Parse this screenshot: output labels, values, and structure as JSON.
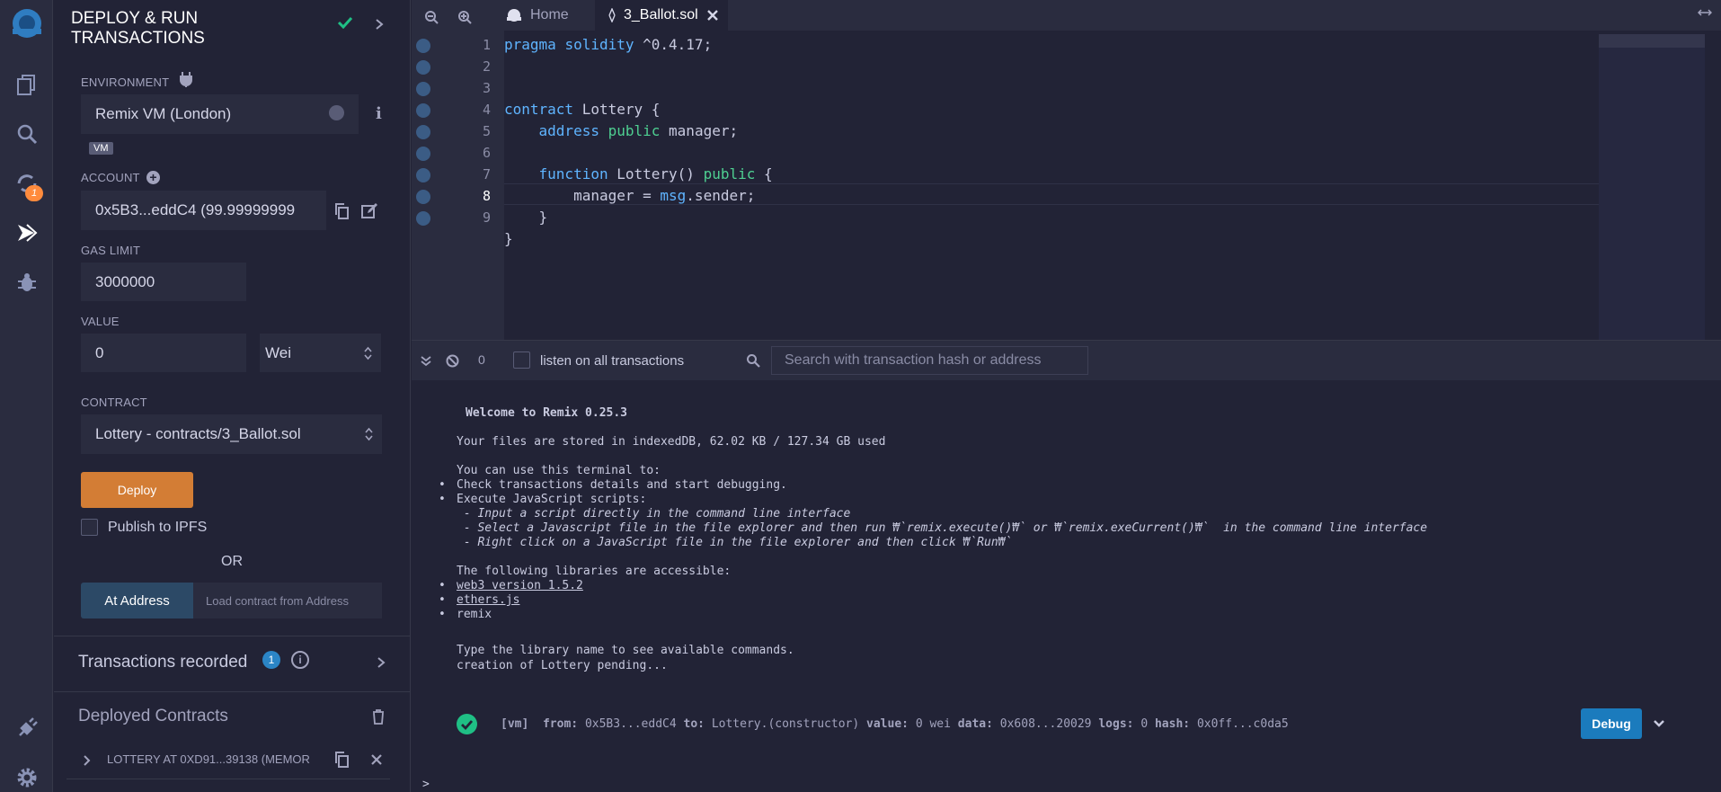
{
  "panel": {
    "title": "DEPLOY & RUN TRANSACTIONS",
    "environment_label": "ENVIRONMENT",
    "environment_value": "Remix VM (London)",
    "vm_badge": "VM",
    "account_label": "ACCOUNT",
    "account_value": "0x5B3...eddC4 (99.99999999",
    "gas_limit_label": "GAS LIMIT",
    "gas_limit_value": "3000000",
    "value_label": "VALUE",
    "value_amount": "0",
    "value_unit": "Wei",
    "contract_label": "CONTRACT",
    "contract_value": "Lottery - contracts/3_Ballot.sol",
    "deploy_label": "Deploy",
    "publish_ipfs_label": "Publish to IPFS",
    "or_label": "OR",
    "at_address_label": "At Address",
    "at_address_placeholder": "Load contract from Address",
    "transactions_recorded_label": "Transactions recorded",
    "transactions_recorded_count": "1",
    "deployed_contracts_label": "Deployed Contracts",
    "deployed_instance": "LOTTERY AT 0XD91...39138 (MEMOR"
  },
  "iconbar": {
    "plugin_badge": "1"
  },
  "tabs": {
    "home_label": "Home",
    "file_label": "3_Ballot.sol"
  },
  "editor": {
    "line_numbers": [
      "1",
      "2",
      "3",
      "4",
      "5",
      "6",
      "7",
      "8",
      "9"
    ]
  },
  "terminal": {
    "tx_count": "0",
    "listen_label": "listen on all transactions",
    "search_placeholder": "Search with transaction hash or address",
    "welcome": "Welcome to Remix 0.25.3",
    "storage": "Your files are stored in indexedDB, 62.02 KB / 127.34 GB used",
    "can_use": "You can use this terminal to:",
    "b1": "Check transactions details and start debugging.",
    "b2": "Execute JavaScript scripts:",
    "s1": " - Input a script directly in the command line interface",
    "s2": " - Select a Javascript file in the file explorer and then run ₩`remix.execute()₩` or ₩`remix.exeCurrent()₩`  in the command line interface",
    "s3": " - Right click on a JavaScript file in the file explorer and then click ₩`Run₩`",
    "libs": "The following libraries are accessible:",
    "lib1": "web3 version 1.5.2",
    "lib2": "ethers.js",
    "lib3": "remix",
    "type_lib": "Type the library name to see available commands.",
    "pending": "creation of Lottery pending...",
    "tx_vm": "[vm]",
    "tx_from_label": "from:",
    "tx_from": "0x5B3...eddC4",
    "tx_to_label": "to:",
    "tx_to": "Lottery.(constructor)",
    "tx_value_label": "value:",
    "tx_value": "0 wei",
    "tx_data_label": "data:",
    "tx_data": "0x608...20029",
    "tx_logs_label": "logs:",
    "tx_logs": "0",
    "tx_hash_label": "hash:",
    "tx_hash": "0x0ff...c0da5",
    "debug_label": "Debug",
    "prompt": ">"
  }
}
